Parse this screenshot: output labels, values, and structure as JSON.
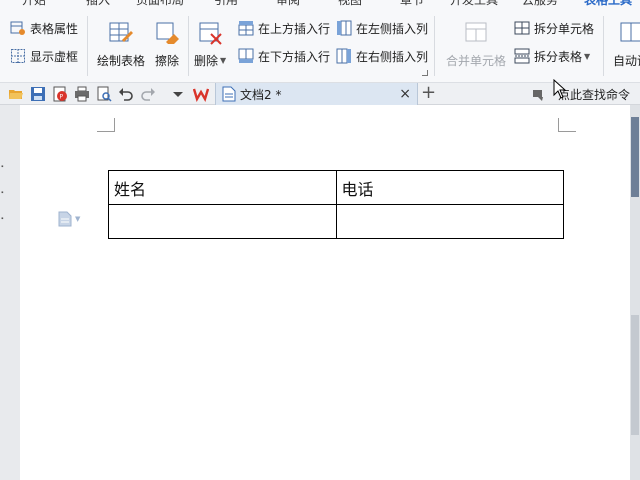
{
  "menu_tabs": [
    {
      "label": "开始",
      "active": false
    },
    {
      "label": "插入",
      "active": false
    },
    {
      "label": "页面布局",
      "active": false
    },
    {
      "label": "引用",
      "active": false
    },
    {
      "label": "审阅",
      "active": false
    },
    {
      "label": "视图",
      "active": false
    },
    {
      "label": "章节",
      "active": false
    },
    {
      "label": "开发工具",
      "active": false
    },
    {
      "label": "云服务",
      "active": false
    },
    {
      "label": "表格工具",
      "active": true
    }
  ],
  "ribbon": {
    "table_properties": "表格属性",
    "show_gridlines": "显示虚框",
    "draw_table": "绘制表格",
    "erase": "擦除",
    "delete": "删除",
    "insert_row_above": "在上方插入行",
    "insert_row_below": "在下方插入行",
    "insert_col_left": "在左侧插入列",
    "insert_col_right": "在右侧插入列",
    "merge_cells": "合并单元格",
    "split_cells": "拆分单元格",
    "split_table": "拆分表格",
    "autofit": "自动调"
  },
  "tab_bar": {
    "doc_tab_title": "文档2 *",
    "close_glyph": "×",
    "add_glyph": "+",
    "find_command": "点此查找命令"
  },
  "document": {
    "table": [
      [
        "姓名",
        "电话"
      ],
      [
        "",
        ""
      ]
    ]
  },
  "colors": {
    "accent": "#2a6ac8",
    "ribbon_bg": "#f7f8fa",
    "tab_active_bg": "#dce6f2",
    "wps_red": "#d9342b"
  }
}
